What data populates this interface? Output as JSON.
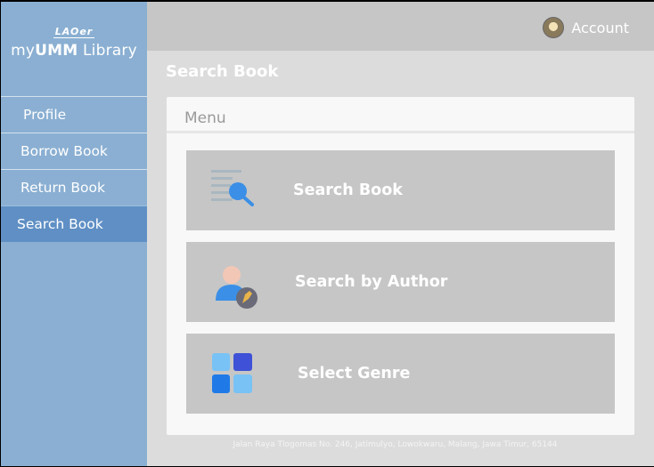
{
  "sidebar": {
    "logo_top": "LAOer",
    "logo_my": "my",
    "logo_umm": "UMM",
    "logo_library": "Library",
    "items": [
      {
        "label": "Profile"
      },
      {
        "label": "Borrow Book"
      },
      {
        "label": "Return Book"
      },
      {
        "label": "Search Book"
      }
    ],
    "active_index": 3
  },
  "header": {
    "account_label": "Account"
  },
  "page": {
    "title": "Search Book"
  },
  "menu": {
    "title": "Menu",
    "cards": [
      {
        "label": "Search Book",
        "icon": "search-document-icon"
      },
      {
        "label": "Search by Author",
        "icon": "author-pen-icon"
      },
      {
        "label": "Select Genre",
        "icon": "grid-tiles-icon"
      }
    ]
  },
  "footer": {
    "address": "Jalan Raya Tlogomas No. 246, Jatimulyo, Lowokwaru, Malang, Jawa Timur, 65144"
  },
  "colors": {
    "sidebar": "#8aafd2",
    "sidebar_active": "#5f8fc4",
    "header": "#c6c6c6",
    "card": "#c6c6c6",
    "icon_blue": "#3b8fe6",
    "icon_dark_blue": "#3f51d6",
    "icon_light_blue": "#78c2f5"
  }
}
